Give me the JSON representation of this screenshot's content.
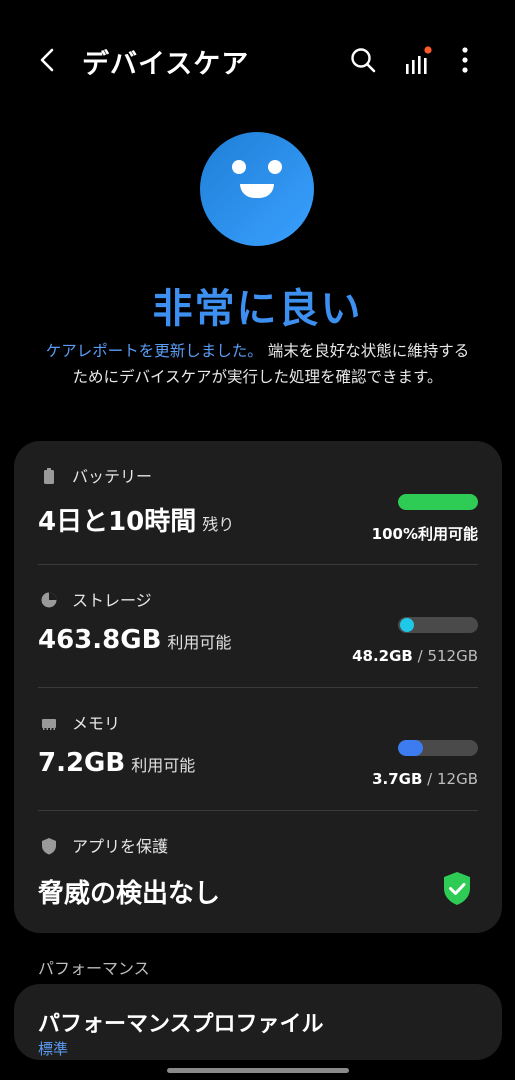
{
  "header": {
    "title": "デバイスケア"
  },
  "status": {
    "rating": "非常に良い",
    "link_text": "ケアレポートを更新しました。",
    "desc_text": " 端末を良好な状態に維持するためにデバイスケアが実行した処理を確認できます。"
  },
  "battery": {
    "label": "バッテリー",
    "value": "4日と10時間",
    "suffix": "残り",
    "status": "100%利用可能",
    "fill_fraction": 1.0,
    "color": "#2ecc55"
  },
  "storage": {
    "label": "ストレージ",
    "value": "463.8GB",
    "suffix": "利用可能",
    "used": "48.2GB",
    "separator": " / ",
    "total": "512GB",
    "fill_fraction": 0.094,
    "color": "#1ec8e8"
  },
  "memory": {
    "label": "メモリ",
    "value": "7.2GB",
    "suffix": "利用可能",
    "used": "3.7GB",
    "separator": " / ",
    "total": "12GB",
    "fill_fraction": 0.31,
    "color": "#3d7cf0"
  },
  "protection": {
    "label": "アプリを保護",
    "value": "脅威の検出なし",
    "color": "#2ecc55"
  },
  "performance": {
    "section_label": "パフォーマンス",
    "name": "パフォーマンスプロファイル",
    "mode": "標準"
  },
  "icons": [
    "back-arrow-icon",
    "search-icon",
    "signal-report-icon",
    "more-options-icon",
    "battery-icon",
    "storage-pie-icon",
    "memory-chip-icon",
    "shield-icon",
    "shield-check-icon",
    "smiley-face-icon"
  ]
}
